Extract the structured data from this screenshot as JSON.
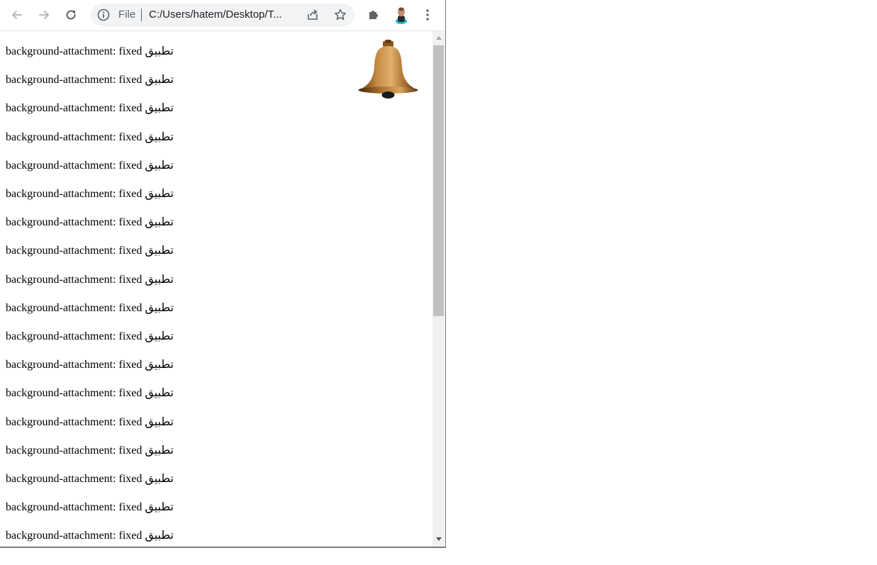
{
  "browser": {
    "back_icon": "arrow-left",
    "forward_icon": "arrow-right",
    "reload_icon": "reload",
    "omnibox": {
      "scheme_label": "File",
      "url": "C:/Users/hatem/Desktop/T..."
    },
    "share_icon": "share",
    "bookmark_icon": "star",
    "extensions_icon": "puzzle",
    "profile_icon": "avatar",
    "menu_icon": "vertical-dots"
  },
  "page": {
    "lines": [
      {
        "code": "background-attachment: fixed",
        "arabic": "تطبيق"
      },
      {
        "code": "background-attachment: fixed",
        "arabic": "تطبيق"
      },
      {
        "code": "background-attachment: fixed",
        "arabic": "تطبيق"
      },
      {
        "code": "background-attachment: fixed",
        "arabic": "تطبيق"
      },
      {
        "code": "background-attachment: fixed",
        "arabic": "تطبيق"
      },
      {
        "code": "background-attachment: fixed",
        "arabic": "تطبيق"
      },
      {
        "code": "background-attachment: fixed",
        "arabic": "تطبيق"
      },
      {
        "code": "background-attachment: fixed",
        "arabic": "تطبيق"
      },
      {
        "code": "background-attachment: fixed",
        "arabic": "تطبيق"
      },
      {
        "code": "background-attachment: fixed",
        "arabic": "تطبيق"
      },
      {
        "code": "background-attachment: fixed",
        "arabic": "تطبيق"
      },
      {
        "code": "background-attachment: fixed",
        "arabic": "تطبيق"
      },
      {
        "code": "background-attachment: fixed",
        "arabic": "تطبيق"
      },
      {
        "code": "background-attachment: fixed",
        "arabic": "تطبيق"
      },
      {
        "code": "background-attachment: fixed",
        "arabic": "تطبيق"
      },
      {
        "code": "background-attachment: fixed",
        "arabic": "تطبيق"
      },
      {
        "code": "background-attachment: fixed",
        "arabic": "تطبيق"
      },
      {
        "code": "background-attachment: fixed",
        "arabic": "تطبيق"
      }
    ],
    "background_image": "bell-image"
  },
  "colors": {
    "toolbar_bg": "#ffffff",
    "omnibox_bg": "#f1f3f4",
    "icon": "#5f6368",
    "scroll_thumb": "#c1c1c1"
  }
}
